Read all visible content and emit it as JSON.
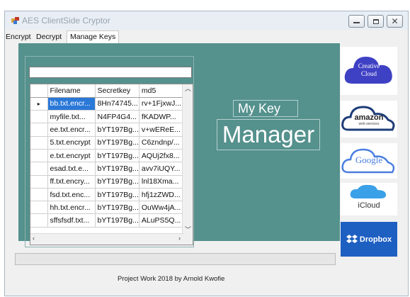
{
  "window": {
    "title": "AES ClientSide Cryptor"
  },
  "tabs": [
    {
      "label": "Encrypt"
    },
    {
      "label": "Decrypt"
    },
    {
      "label": "Manage Keys"
    }
  ],
  "key_manager": {
    "search_value": "",
    "heading_small": "My Key",
    "heading_large": "Manager",
    "columns": [
      "Filename",
      "Secretkey",
      "md5"
    ],
    "rows": [
      {
        "filename": "bb.txt.encr...",
        "secretkey": "8Hn74745...",
        "md5": "rv+1FjxwJ...",
        "selected": true
      },
      {
        "filename": "myfile.txt...",
        "secretkey": "N4FP4G4...",
        "md5": "fKADWP..."
      },
      {
        "filename": "ee.txt.encr...",
        "secretkey": "bYT197Bg...",
        "md5": "v+wEReE..."
      },
      {
        "filename": "5.txt.encrypt",
        "secretkey": "bYT197Bg...",
        "md5": "C6zndnp/..."
      },
      {
        "filename": "e.txt.encrypt",
        "secretkey": "bYT197Bg...",
        "md5": "AQUj2fx8..."
      },
      {
        "filename": "esad.txt.e...",
        "secretkey": "bYT197Bg...",
        "md5": "avv7iUQY..."
      },
      {
        "filename": "ff.txt.encry...",
        "secretkey": "bYT197Bg...",
        "md5": "lnl18Xma..."
      },
      {
        "filename": "fsd.txt.enc...",
        "secretkey": "bYT197Bg...",
        "md5": "hfj1zZWD..."
      },
      {
        "filename": "hh.txt.encr...",
        "secretkey": "bYT197Bg...",
        "md5": "OuWw4jA..."
      },
      {
        "filename": "sffsfsdf.txt...",
        "secretkey": "bYT197Bg...",
        "md5": "ALuPS5Q..."
      }
    ]
  },
  "cloud_services": [
    {
      "name": "Creative Cloud",
      "label_line1": "Creative",
      "label_line2": "Cloud",
      "color": "#3a3fbf"
    },
    {
      "name": "Amazon Web Services",
      "label": "amazon",
      "sublabel": "web services",
      "color": "#f39a1e"
    },
    {
      "name": "Google",
      "label": "Google",
      "color": "#4a7fe0"
    },
    {
      "name": "iCloud",
      "label": "iCloud",
      "color": "#3aa0e8"
    },
    {
      "name": "Dropbox",
      "label": "Dropbox",
      "color": "#1e5fc2"
    }
  ],
  "progress": {
    "value": 0
  },
  "footer": {
    "credit": "Project Work 2018 by Arnold Kwofie"
  },
  "colors": {
    "panel": "#55918d",
    "selection": "#2a78d8"
  }
}
